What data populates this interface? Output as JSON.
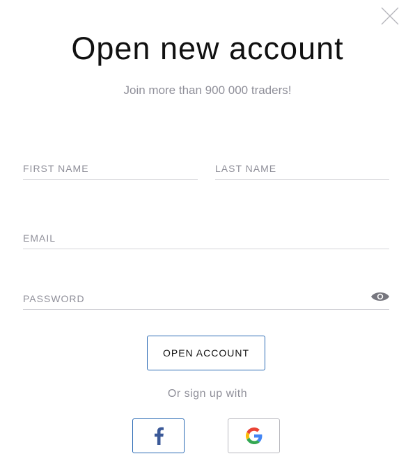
{
  "dialog": {
    "title": "Open new account",
    "subtitle": "Join more than 900 000 traders!"
  },
  "form": {
    "first_name": {
      "placeholder": "FIRST NAME",
      "value": ""
    },
    "last_name": {
      "placeholder": "LAST NAME",
      "value": ""
    },
    "email": {
      "placeholder": "EMAIL",
      "value": ""
    },
    "password": {
      "placeholder": "PASSWORD",
      "value": ""
    },
    "submit_label": "OPEN ACCOUNT"
  },
  "social": {
    "prompt": "Or sign up with",
    "providers": [
      {
        "name": "facebook",
        "icon": "facebook-icon"
      },
      {
        "name": "google",
        "icon": "google-icon"
      }
    ]
  },
  "colors": {
    "accent": "#2a6ab4",
    "muted_text": "#8f8f99",
    "divider": "#d3d3d8",
    "facebook": "#3b5998"
  }
}
